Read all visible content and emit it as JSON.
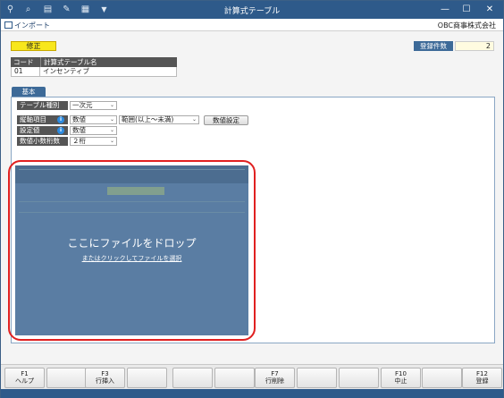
{
  "window": {
    "title": "計算式テーブル"
  },
  "toolbar_icons": [
    "user-add-icon",
    "search-icon",
    "print-icon",
    "tools-icon",
    "excel-icon",
    "dropdown-arrow-icon"
  ],
  "window_controls": {
    "minimize": "—",
    "maximize": "☐",
    "close": "✕"
  },
  "menu": {
    "import_label": "インポート",
    "company": "OBC商事株式会社"
  },
  "mode_badge": "修正",
  "record_count": {
    "label": "登録件数",
    "value": "2"
  },
  "header_table": {
    "col_code": "コード",
    "col_name": "計算式テーブル名",
    "code": "01",
    "name": "インセンティブ"
  },
  "tab": "基本",
  "fields": {
    "table_type": {
      "label": "テーブル種別",
      "value": "一次元"
    },
    "axis": {
      "label": "縦軸項目",
      "value": "数値",
      "range": "範囲(以上～未満)"
    },
    "setting": {
      "label": "設定値",
      "value": "数値"
    },
    "decimals": {
      "label": "数値小数桁数",
      "value": "２桁"
    },
    "numeric_button": "数値設定"
  },
  "drop_zone": {
    "title": "ここにファイルをドロップ",
    "link": "またはクリックしてファイルを選択"
  },
  "function_keys": [
    {
      "key": "F1",
      "label": "ヘルプ"
    },
    {
      "key": "",
      "label": ""
    },
    {
      "key": "F3",
      "label": "行挿入"
    },
    {
      "key": "",
      "label": ""
    },
    {
      "key": "",
      "label": ""
    },
    {
      "key": "",
      "label": ""
    },
    {
      "key": "F7",
      "label": "行削除"
    },
    {
      "key": "",
      "label": ""
    },
    {
      "key": "",
      "label": ""
    },
    {
      "key": "F10",
      "label": "中止"
    },
    {
      "key": "",
      "label": ""
    },
    {
      "key": "F12",
      "label": "登録"
    }
  ]
}
